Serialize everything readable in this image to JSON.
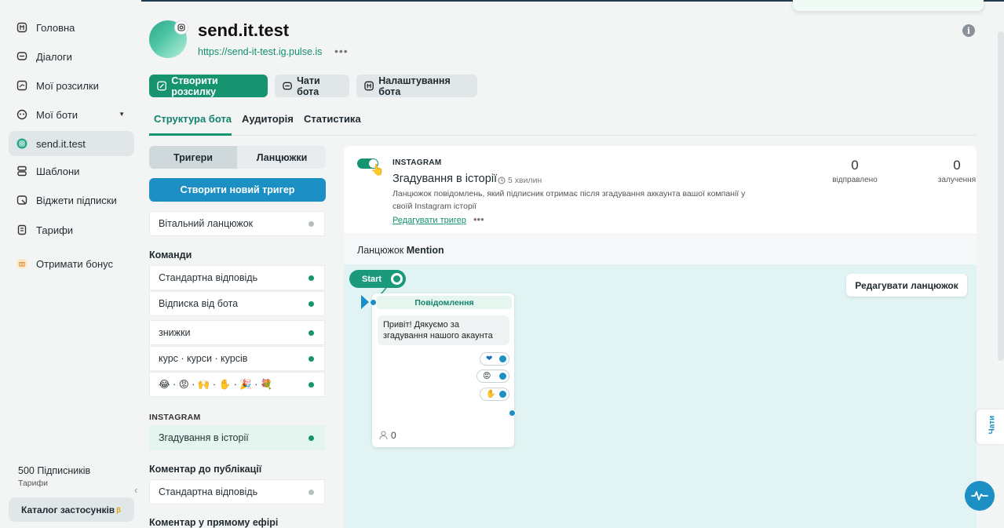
{
  "sidebar": {
    "items": [
      {
        "label": "Головна",
        "icon": "home-icon"
      },
      {
        "label": "Діалоги",
        "icon": "chat-icon"
      },
      {
        "label": "Мої розсилки",
        "icon": "send-icon"
      },
      {
        "label": "Мої боти",
        "icon": "bot-icon"
      },
      {
        "label": "send.it.test",
        "icon": "instagram-icon"
      },
      {
        "label": "Шаблони",
        "icon": "templates-icon"
      },
      {
        "label": "Віджети підписки",
        "icon": "widget-icon"
      },
      {
        "label": "Тарифи",
        "icon": "tariff-icon"
      },
      {
        "label": "Отримати бонус",
        "icon": "gift-icon"
      }
    ],
    "subscribers": "500 Підписників",
    "tariffs_link": "Тарифи",
    "catalog": "Каталог застосунків",
    "catalog_badge": "β"
  },
  "header": {
    "title": "send.it.test",
    "link": "https://send-it-test.ig.pulse.is",
    "more": "•••"
  },
  "actions": {
    "create_mailing": "Створити розсилку",
    "bot_chats": "Чати бота",
    "bot_settings": "Налаштування бота"
  },
  "tabs": [
    "Структура бота",
    "Аудиторія",
    "Статистика"
  ],
  "segment": [
    "Тригери",
    "Ланцюжки"
  ],
  "create_trigger": "Створити новий тригер",
  "welcome_chain": "Вітальний ланцюжок",
  "commands_title": "Команди",
  "commands": [
    "Стандартна відповідь",
    "Відписка від бота"
  ],
  "keywords": [
    "знижки",
    "курс · курси · курсів"
  ],
  "emoji_row": "😂 · 😡 · 🙌 · ✋ · 🎉 · 💐",
  "instagram_section": "INSTAGRAM",
  "story_mention": "Згадування в історії",
  "post_comment_title": "Коментар до публікації",
  "post_comment_item": "Стандартна відповідь",
  "live_comment_title": "Коментар у прямому ефірі",
  "trigger": {
    "platform": "INSTAGRAM",
    "title": "Згадування в історії",
    "time": "5 хвилин",
    "description": "Ланцюжок повідомлень, який підписник отримає після згадування аккаунта вашої компанії у своїй Instagram історії",
    "edit": "Редагувати тригер",
    "more": "•••",
    "sent_value": "0",
    "sent_label": "відправлено",
    "engaged_value": "0",
    "engaged_label": "залучення"
  },
  "chain": {
    "label": "Ланцюжок",
    "name": "Mention",
    "edit_button": "Редагувати ланцюжок",
    "start": "Start",
    "node_title": "Повідомлення",
    "message": "Привіт! Дякуємо за згадування нашого акаунта",
    "replies": [
      "❤",
      "😡",
      "✋"
    ],
    "count": "0"
  },
  "chat_tab": "Чати",
  "colors": {
    "brand_green": "#16936f",
    "brand_blue": "#1c8fc4",
    "canvas_bg": "#e1f4f3"
  }
}
